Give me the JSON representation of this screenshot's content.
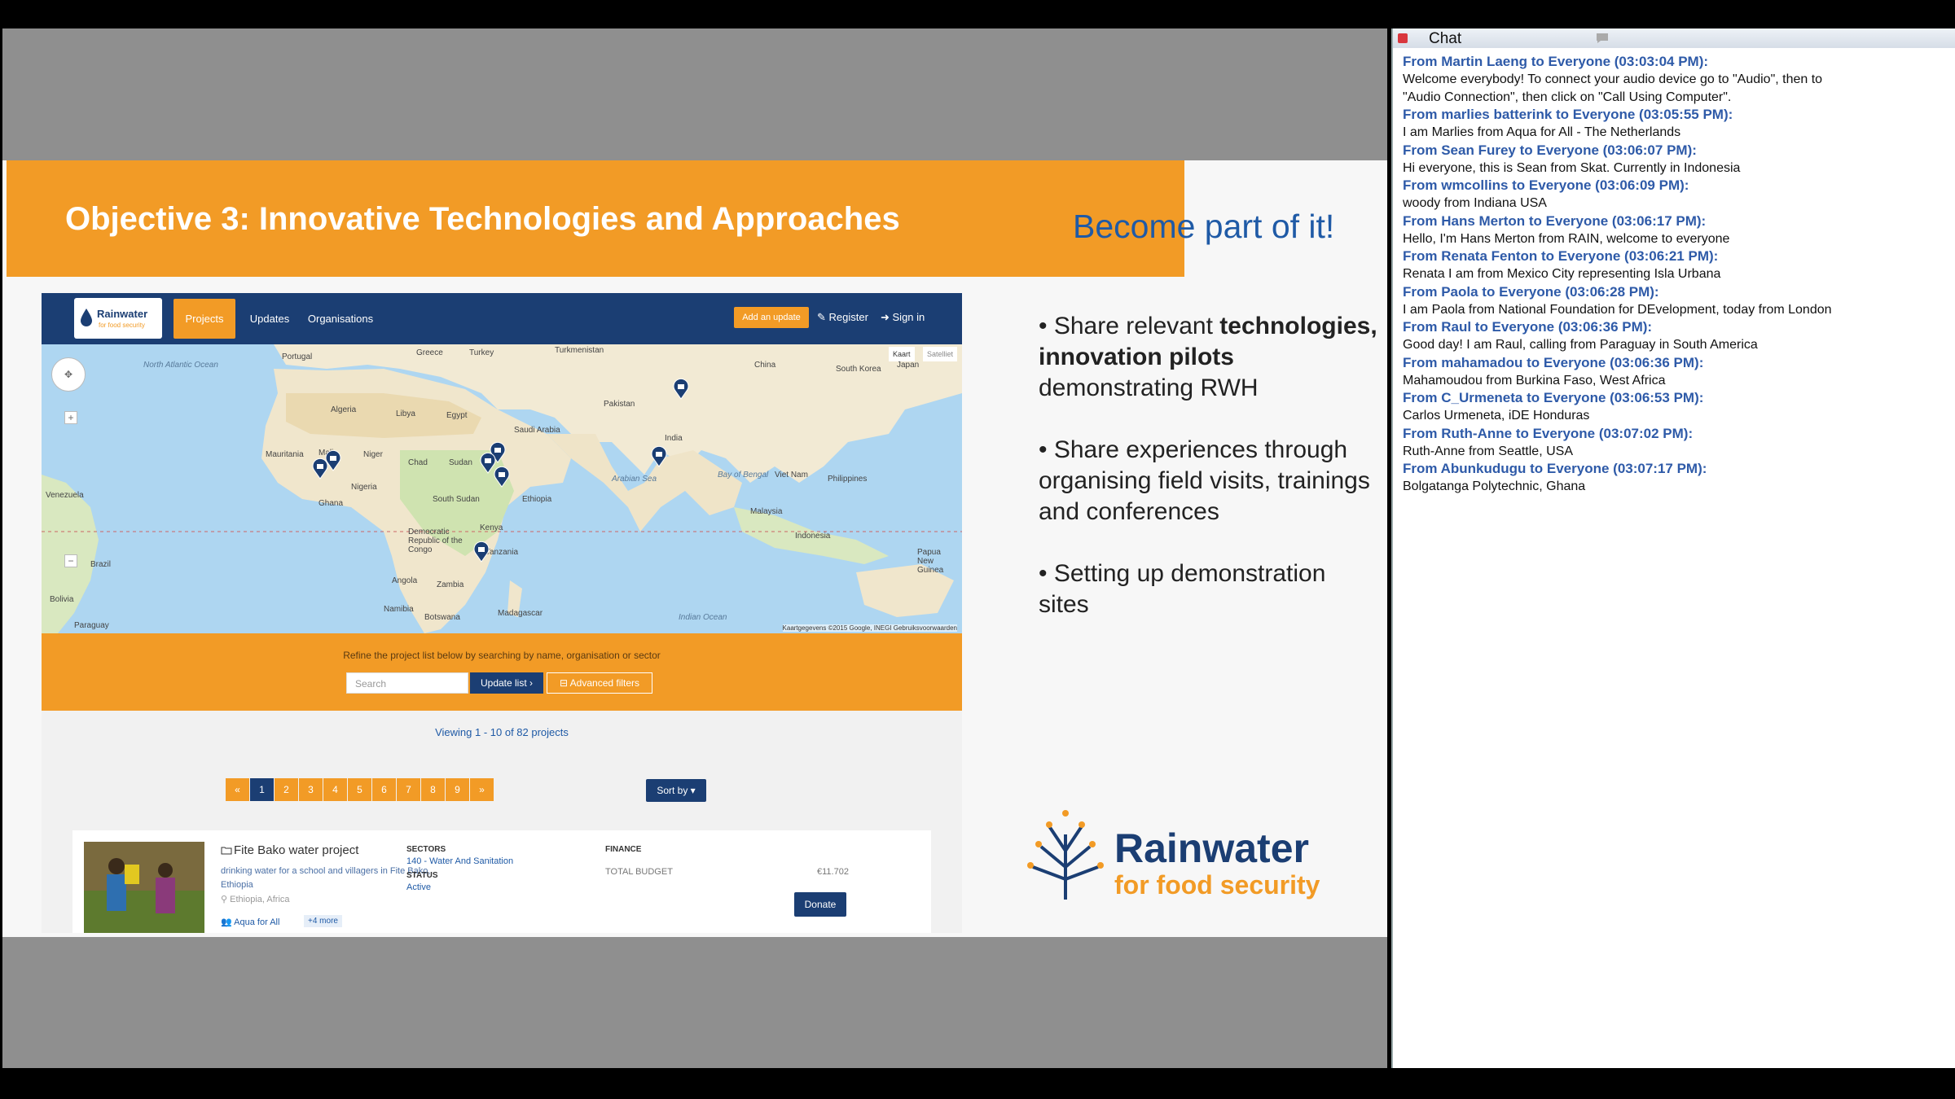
{
  "slide": {
    "title": "Objective 3: Innovative Technologies and Approaches",
    "tagline": "Become part of it!",
    "bullets": [
      {
        "pre": "• Share relevant ",
        "bold": "technologies,  innovation pilots",
        "post": " demonstrating RWH"
      },
      {
        "pre": "• Share experiences through organising field visits, trainings and conferences",
        "bold": "",
        "post": ""
      },
      {
        "pre": "• Setting up demonstration sites",
        "bold": "",
        "post": ""
      }
    ],
    "logo": {
      "line1": "Rainwater",
      "line2": "for food security"
    }
  },
  "website": {
    "logo": {
      "line1": "Rainwater",
      "line2": "for food security"
    },
    "nav": {
      "projects": "Projects",
      "updates": "Updates",
      "organisations": "Organisations",
      "add_update": "Add an update",
      "register": "Register",
      "sign_in": "Sign in"
    },
    "map": {
      "toggle_map": "Kaart",
      "toggle_sat": "Satelliet",
      "attribution": "Kaartgegevens ©2015 Google, INEGI   Gebruiksvoorwaarden",
      "labels": {
        "north_atlantic": "North Atlantic Ocean",
        "indian_ocean": "Indian Ocean",
        "portugal": "Portugal",
        "greece": "Greece",
        "turkey": "Turkey",
        "turkmenistan": "Turkmenistan",
        "china": "China",
        "south_korea": "South Korea",
        "japan": "Japan",
        "algeria": "Algeria",
        "libya": "Libya",
        "egypt": "Egypt",
        "saudi_arabia": "Saudi Arabia",
        "pakistan": "Pakistan",
        "mauritania": "Mauritania",
        "mali": "Mali",
        "niger": "Niger",
        "chad": "Chad",
        "sudan": "Sudan",
        "nigeria": "Nigeria",
        "ghana": "Ghana",
        "south_sudan": "South Sudan",
        "ethiopia": "Ethiopia",
        "kenya": "Kenya",
        "drc": "Democratic Republic of the Congo",
        "tanzania": "Tanzania",
        "angola": "Angola",
        "zambia": "Zambia",
        "namibia": "Namibia",
        "botswana": "Botswana",
        "madagascar": "Madagascar",
        "india": "India",
        "bay_of_bengal": "Bay of Bengal",
        "arabian_sea": "Arabian Sea",
        "vietnam": "Viet Nam",
        "philippines": "Philippines",
        "malaysia": "Malaysia",
        "indonesia": "Indonesia",
        "brazil": "Brazil",
        "bolivia": "Bolivia",
        "paraguay": "Paraguay",
        "venezuela": "Venezuela",
        "papua": "Papua New Guinea"
      }
    },
    "filter": {
      "hint": "Refine the project list below by searching by name, organisation or sector",
      "search_placeholder": "Search",
      "update_btn": "Update list ›",
      "advanced_btn": "Advanced filters"
    },
    "viewing": "Viewing 1 - 10 of 82 projects",
    "pagination": [
      "«",
      "1",
      "2",
      "3",
      "4",
      "5",
      "6",
      "7",
      "8",
      "9",
      "»"
    ],
    "sort_btn": "Sort by ▾",
    "project": {
      "title": "Fite Bako water project",
      "description": "drinking water for a school and villagers in Fite Bako, Ethiopia",
      "location": "Ethiopia, Africa",
      "org": "Aqua for All",
      "more": "+4 more",
      "sectors_head": "SECTORS",
      "sectors_val": "140 - Water And Sanitation",
      "status_head": "STATUS",
      "status_val": "Active",
      "finance_head": "FINANCE",
      "budget_label": "TOTAL BUDGET",
      "budget_val": "€11.702",
      "donate": "Donate"
    }
  },
  "chat": {
    "title": "Chat",
    "messages": [
      {
        "from": "From Martin Laeng to Everyone (03:03:04 PM):",
        "lines": [
          "Welcome everybody! To connect your audio device go to \"Audio\", then to",
          "\"Audio Connection\", then click on \"Call Using Computer\"."
        ]
      },
      {
        "from": "From marlies batterink to Everyone (03:05:55 PM):",
        "lines": [
          "I am Marlies from Aqua for All - The Netherlands"
        ]
      },
      {
        "from": "From Sean Furey to Everyone (03:06:07 PM):",
        "lines": [
          "Hi everyone, this is Sean from Skat. Currently in Indonesia"
        ]
      },
      {
        "from": "From wmcollins to Everyone (03:06:09 PM):",
        "lines": [
          "woody from Indiana USA"
        ]
      },
      {
        "from": "From Hans Merton to Everyone (03:06:17 PM):",
        "lines": [
          "Hello, I'm Hans Merton from RAIN, welcome to everyone"
        ]
      },
      {
        "from": "From Renata Fenton to Everyone (03:06:21 PM):",
        "lines": [
          "Renata I am from Mexico City representing Isla Urbana"
        ]
      },
      {
        "from": "From Paola to Everyone (03:06:28 PM):",
        "lines": [
          "I am Paola from National Foundation for DEvelopment, today from London"
        ]
      },
      {
        "from": "From Raul to Everyone (03:06:36 PM):",
        "lines": [
          "Good day! I am Raul, calling from Paraguay in South America"
        ]
      },
      {
        "from": "From mahamadou to Everyone (03:06:36 PM):",
        "lines": [
          "Mahamoudou from Burkina Faso, West Africa"
        ]
      },
      {
        "from": "From C_Urmeneta to Everyone (03:06:53 PM):",
        "lines": [
          "Carlos Urmeneta, iDE Honduras"
        ]
      },
      {
        "from": "From Ruth-Anne to Everyone (03:07:02 PM):",
        "lines": [
          "Ruth-Anne from Seattle, USA"
        ]
      },
      {
        "from": "From Abunkudugu to Everyone (03:07:17 PM):",
        "lines": [
          "Bolgatanga Polytechnic, Ghana"
        ]
      }
    ]
  },
  "colors": {
    "orange": "#f29b26",
    "navy": "#1b3e73",
    "chat_blue": "#2e5aa8"
  }
}
